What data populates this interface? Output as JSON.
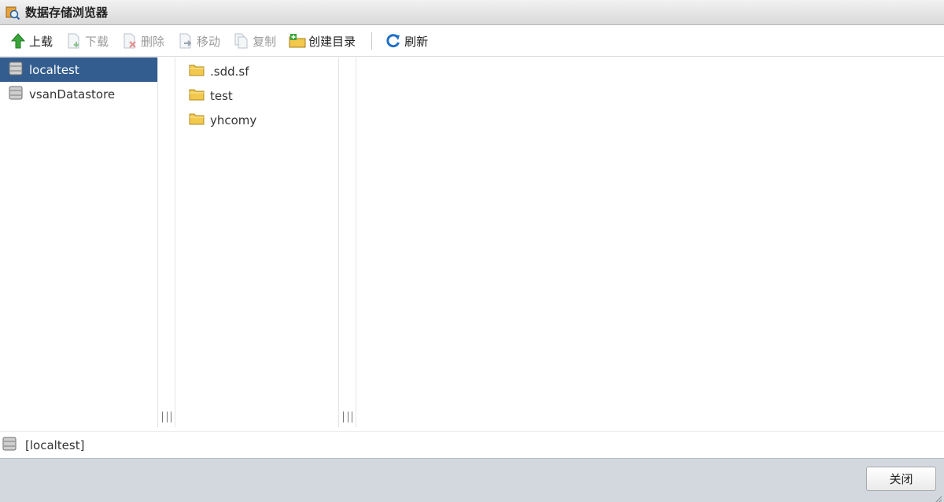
{
  "window": {
    "title": "数据存储浏览器"
  },
  "toolbar": {
    "upload_label": "上载",
    "download_label": "下载",
    "delete_label": "删除",
    "move_label": "移动",
    "copy_label": "复制",
    "mkdir_label": "创建目录",
    "refresh_label": "刷新"
  },
  "datastores": [
    {
      "label": "localtest",
      "selected": true
    },
    {
      "label": "vsanDatastore",
      "selected": false
    }
  ],
  "folders": [
    {
      "label": ".sdd.sf"
    },
    {
      "label": "test"
    },
    {
      "label": "yhcomy"
    }
  ],
  "status": {
    "path": "[localtest]"
  },
  "footer": {
    "close_label": "关闭"
  },
  "colors": {
    "selection": "#335d8f",
    "footer_bg": "#d3d8df",
    "folder": "#f2c94c"
  }
}
